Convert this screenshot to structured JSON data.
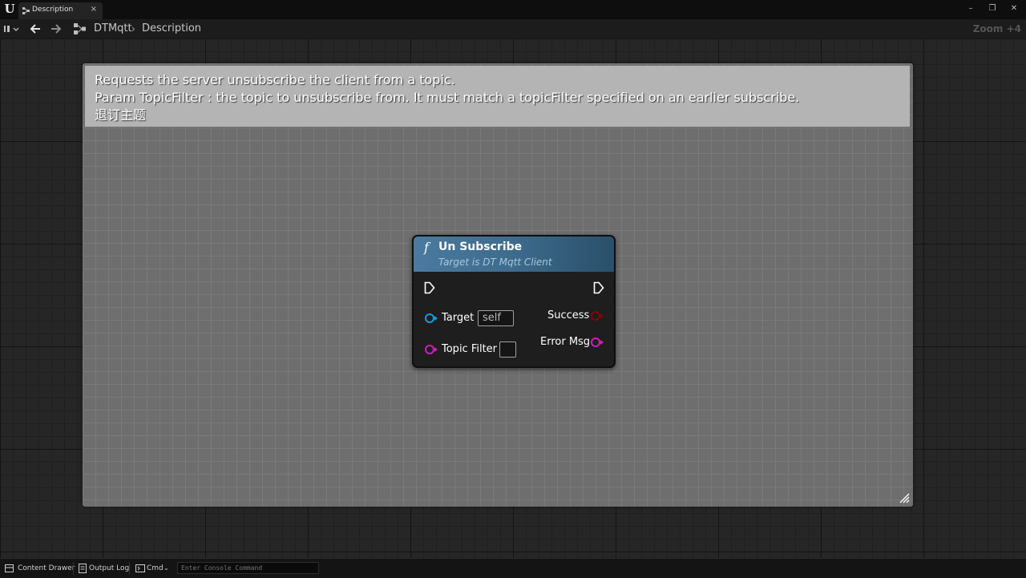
{
  "titlebar": {
    "app_logo": "U",
    "tab_label": "Description",
    "tab_close": "×",
    "minimize": "–",
    "restore": "❐",
    "close": "✕"
  },
  "navbar": {
    "breadcrumb_root": "DTMqtt",
    "breadcrumb_sep": "›",
    "breadcrumb_leaf": "Description",
    "zoom": "Zoom +4"
  },
  "comment": {
    "line1": "Requests the server unsubscribe the client from a topic.",
    "line2": "Param TopicFilter : the topic to unsubscribe from. It must match a topicFilter specified on an earlier subscribe.",
    "line3": "退订主题"
  },
  "node": {
    "icon": "f",
    "title": "Un Subscribe",
    "subtitle": "Target is DT Mqtt Client",
    "inputs": {
      "target_label": "Target",
      "target_value": "self",
      "topic_label": "Topic Filter"
    },
    "outputs": {
      "success_label": "Success",
      "error_label": "Error Msg"
    }
  },
  "statusbar": {
    "content_drawer": "Content Drawer",
    "output_log": "Output Log",
    "cmd": "Cmd",
    "console_placeholder": "Enter Console Command"
  },
  "colors": {
    "exec_pin": "#ffffff",
    "object_pin": "#1b9bd8",
    "string_pin": "#d81ab8",
    "bool_pin": "#8a0000",
    "node_header": "#4b7aa0"
  }
}
